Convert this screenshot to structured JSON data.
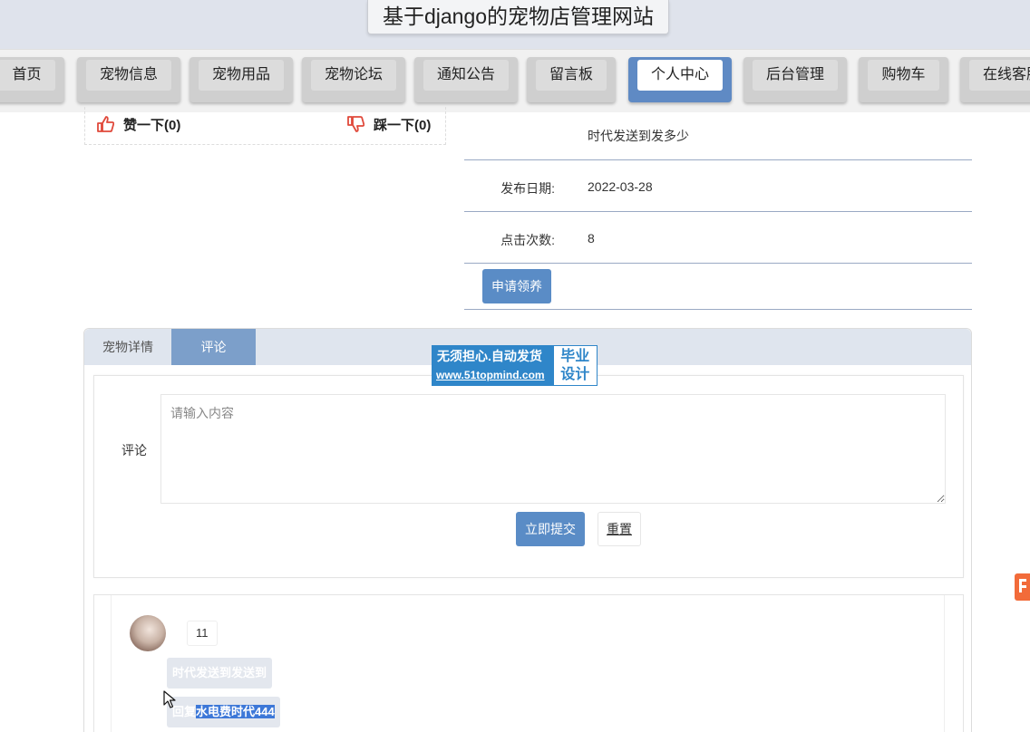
{
  "site": {
    "title": "基于django的宠物店管理网站"
  },
  "nav": {
    "items": [
      {
        "label": "首页"
      },
      {
        "label": "宠物信息"
      },
      {
        "label": "宠物用品"
      },
      {
        "label": "宠物论坛"
      },
      {
        "label": "通知公告"
      },
      {
        "label": "留言板"
      },
      {
        "label": "个人中心",
        "active": true
      },
      {
        "label": "后台管理"
      },
      {
        "label": "购物车"
      },
      {
        "label": "在线客服"
      }
    ]
  },
  "vote": {
    "like_label": "赞一下(0)",
    "dislike_label": "踩一下(0)"
  },
  "info": {
    "description": "时代发送到发多少",
    "publish_date_label": "发布日期:",
    "publish_date": "2022-03-28",
    "clicks_label": "点击次数:",
    "clicks": "8",
    "apply_button": "申请领养"
  },
  "tabs": [
    {
      "label": "宠物详情"
    },
    {
      "label": "评论",
      "active": true
    }
  ],
  "comment_form": {
    "label": "评论",
    "placeholder": "请输入内容",
    "submit": "立即提交",
    "reset": "重置"
  },
  "comments": [
    {
      "author": "11",
      "content": "时代发送到发送到",
      "reply_prefix": "回复",
      "reply_text": "水电费时代444"
    }
  ],
  "watermark": {
    "line1": "无须担心.自动发货",
    "line2": "www.51topmind.com",
    "right_top": "毕业",
    "right_bottom": "设计"
  },
  "colors": {
    "primary_button": "#5a8cc6",
    "active_tab": "#7c9fca",
    "nav_active": "#5f8ac4",
    "watermark": "#2f86c9"
  }
}
